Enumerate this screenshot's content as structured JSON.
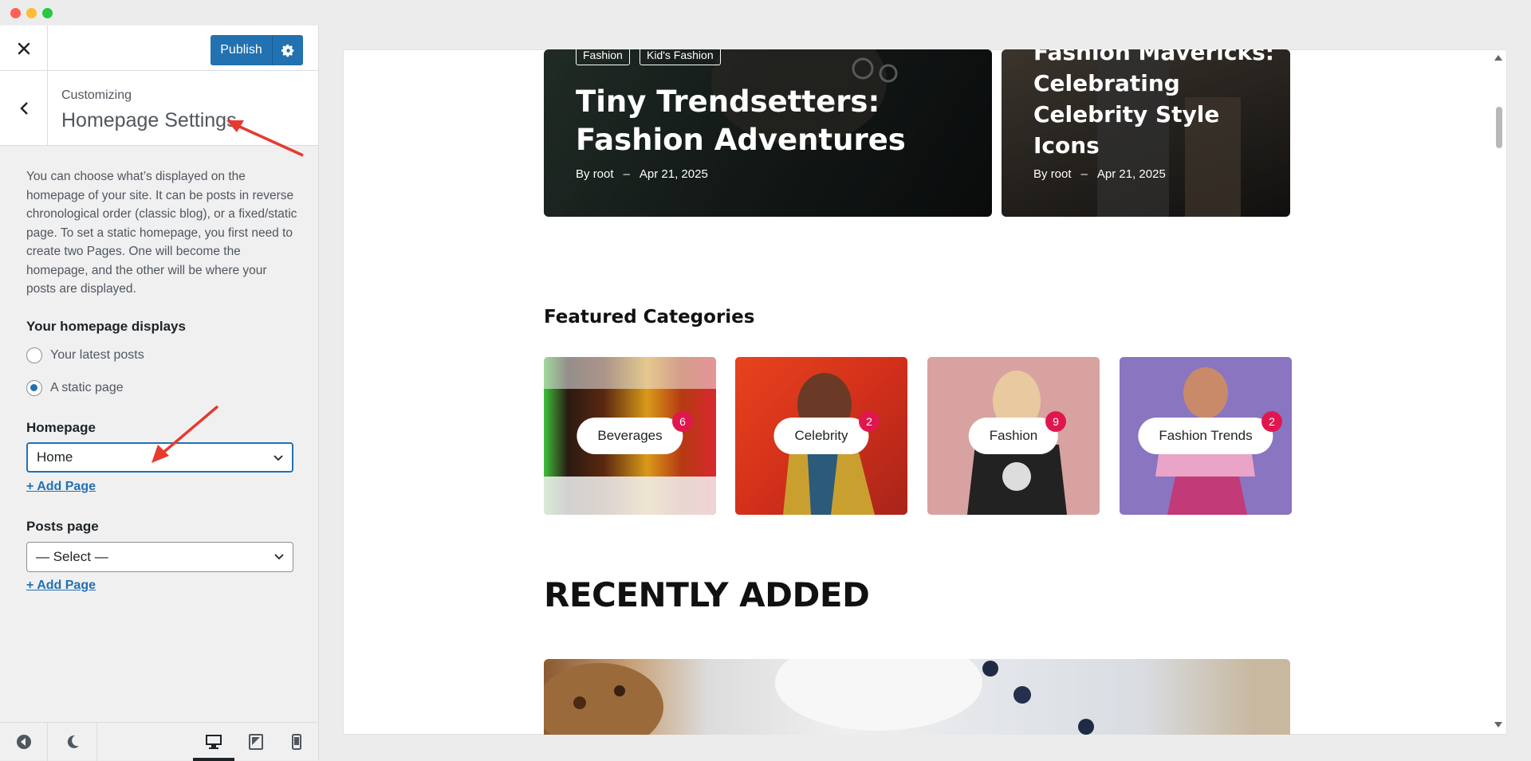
{
  "sidebar": {
    "publish_label": "Publish",
    "customizing_label": "Customizing",
    "section_title": "Homepage Settings",
    "description": "You can choose what’s displayed on the homepage of your site. It can be posts in reverse chronological order (classic blog), or a fixed/static page. To set a static homepage, you first need to create two Pages. One will become the homepage, and the other will be where your posts are displayed.",
    "homepage_displays_label": "Your homepage displays",
    "radio_latest": "Your latest posts",
    "radio_static": "A static page",
    "homepage_label": "Homepage",
    "homepage_value": "Home",
    "add_page_1": "+ Add Page",
    "posts_page_label": "Posts page",
    "posts_page_value": "— Select —",
    "add_page_2": "+ Add Page",
    "selected_radio": "A static page"
  },
  "preview": {
    "card1": {
      "tags": [
        "Fashion",
        "Kid's Fashion"
      ],
      "title_line1": "Tiny Trendsetters:",
      "title_line2": "Fashion Adventures",
      "by": "By",
      "author": "root",
      "dash": "–",
      "date": "Apr 21, 2025"
    },
    "card2": {
      "title_line1": "Fashion Mavericks:",
      "title_line2": "Celebrating",
      "title_line3": "Celebrity Style",
      "title_line4": "Icons",
      "by": "By",
      "author": "root",
      "dash": "–",
      "date": "Apr 21, 2025"
    },
    "featured_title": "Featured Categories",
    "categories": [
      {
        "name": "Beverages",
        "count": "6"
      },
      {
        "name": "Celebrity",
        "count": "2"
      },
      {
        "name": "Fashion",
        "count": "9"
      },
      {
        "name": "Fashion Trends",
        "count": "2"
      }
    ],
    "recent_title": "RECENTLY ADDED"
  },
  "colors": {
    "accent": "#2271b1",
    "badge": "#e0174f",
    "annotation_arrow": "#e8392f"
  },
  "icons": [
    "close-icon",
    "gear-icon",
    "chevron-left-icon",
    "chevron-down-icon",
    "collapse-icon",
    "dark-mode-icon",
    "desktop-icon",
    "tablet-icon",
    "mobile-icon"
  ]
}
